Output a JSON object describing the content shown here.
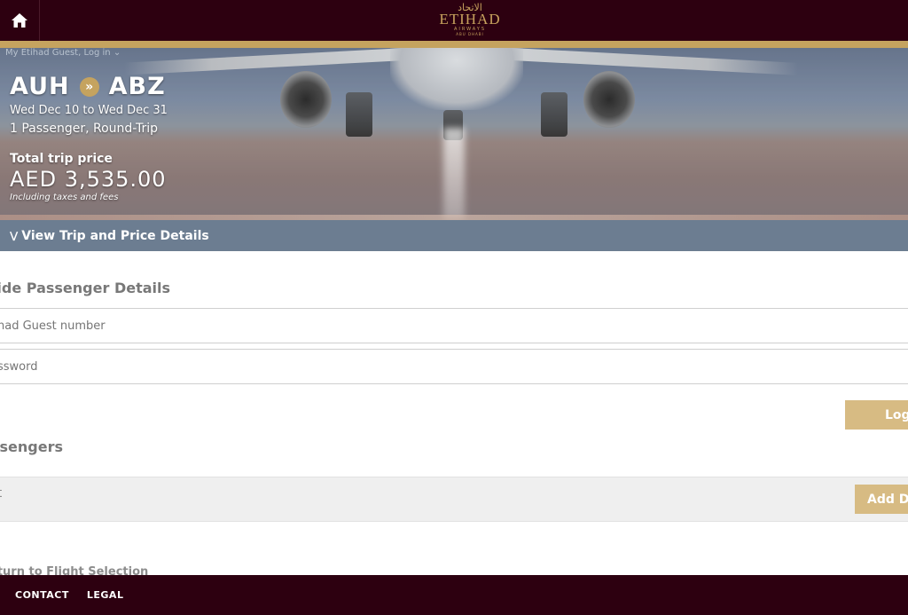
{
  "header": {
    "home_icon": "home-icon",
    "logo": {
      "arabic": "الاتحاد",
      "name": "ETIHAD",
      "sub": "AIRWAYS",
      "city": "ABU DHABI"
    }
  },
  "account": {
    "login_link": "My Etihad Guest, Log in"
  },
  "trip": {
    "origin": "AUH",
    "destination": "ABZ",
    "dates": "Wed Dec 10 to Wed Dec 31",
    "passengers": "1 Passenger, Round-Trip",
    "total_label": "Total trip price",
    "total_price": "AED 3,535.00",
    "price_note": "Including taxes and fees",
    "details_toggle": "View Trip and Price Details"
  },
  "passenger_details": {
    "title": "vide Passenger Details",
    "guest_number_placeholder": "had Guest number",
    "password_placeholder": "ssword",
    "login_button": "Log"
  },
  "passengers": {
    "title": "ssengers",
    "adult_label": "ult",
    "add_details_button": "Add De"
  },
  "return_link": "eturn to Flight Selection",
  "footer": {
    "contact": "CONTACT",
    "legal": "LEGAL"
  },
  "colors": {
    "brand_dark": "#2d0010",
    "gold": "#c5a35f",
    "button_gold": "#d7bb83",
    "details_bar": "#6c7d91"
  }
}
